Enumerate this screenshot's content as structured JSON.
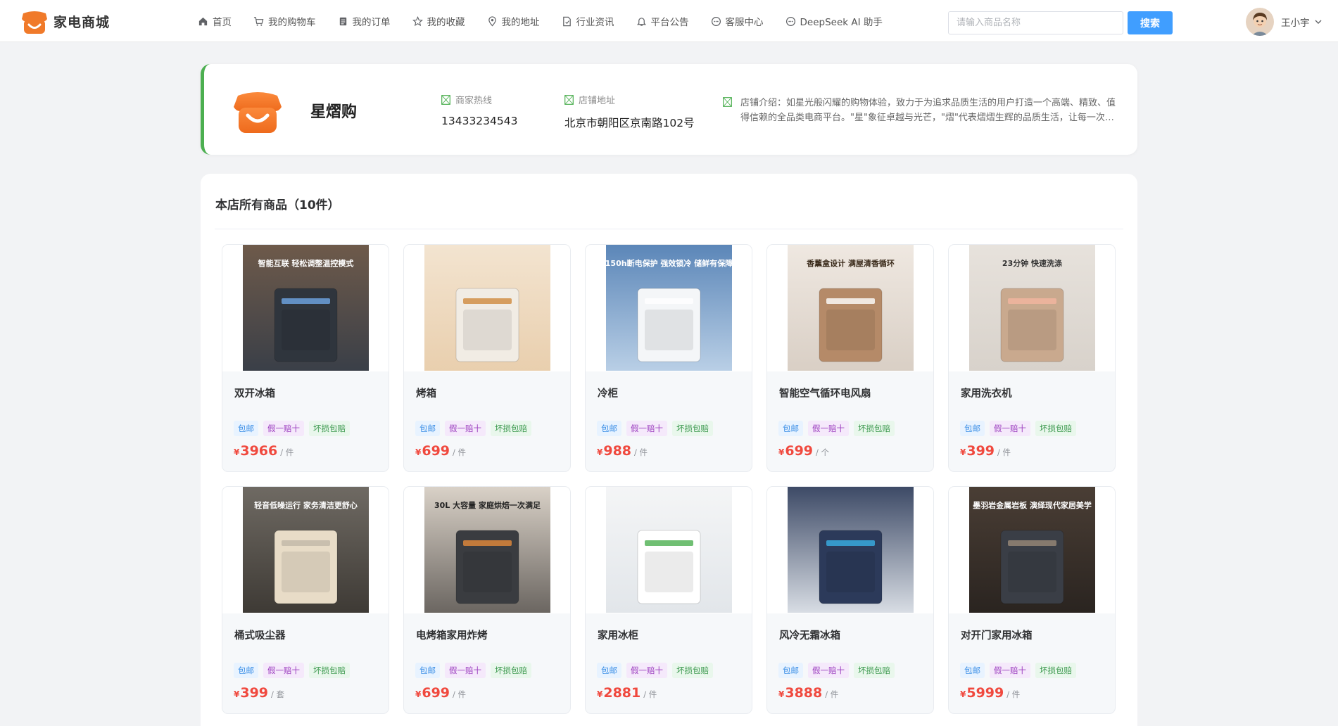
{
  "header": {
    "brand": "家电商城",
    "nav": [
      {
        "label": "首页",
        "icon": "home-icon"
      },
      {
        "label": "我的购物车",
        "icon": "cart-icon"
      },
      {
        "label": "我的订单",
        "icon": "order-icon"
      },
      {
        "label": "我的收藏",
        "icon": "star-icon"
      },
      {
        "label": "我的地址",
        "icon": "location-icon"
      },
      {
        "label": "行业资讯",
        "icon": "document-icon"
      },
      {
        "label": "平台公告",
        "icon": "bell-icon"
      },
      {
        "label": "客服中心",
        "icon": "chat-icon"
      },
      {
        "label": "DeepSeek AI 助手",
        "icon": "chat-icon"
      }
    ],
    "search_placeholder": "请输入商品名称",
    "search_button": "搜索",
    "user_name": "王小宇"
  },
  "shop": {
    "name": "星熠购",
    "hotline_label": "商家热线",
    "hotline": "13433234543",
    "address_label": "店铺地址",
    "address": "北京市朝阳区京南路102号",
    "intro": "店铺介绍：如星光般闪耀的购物体验，致力于为追求品质生活的用户打造一个高端、精致、值得信赖的全品类电商平台。\"星\"象征卓越与光芒，\"熠\"代表熠熠生辉的品质生活，让每一次购物都成为美好的享受。"
  },
  "products_section": {
    "title": "本店所有商品（10件）"
  },
  "tags": [
    "包邮",
    "假一赔十",
    "坏损包赔"
  ],
  "currency": "¥",
  "products": [
    {
      "name": "双开冰箱",
      "price": "3966",
      "unit": "/ 件",
      "img_caption": "智能互联 轻松调整温控模式"
    },
    {
      "name": "烤箱",
      "price": "699",
      "unit": "/ 件",
      "img_caption": ""
    },
    {
      "name": "冷柜",
      "price": "988",
      "unit": "/ 件",
      "img_caption": "150h断电保护 强效锁冷 储鲜有保障"
    },
    {
      "name": "智能空气循环电风扇",
      "price": "699",
      "unit": "/ 个",
      "img_caption": "香薰盒设计 满屋清香循环"
    },
    {
      "name": "家用洗衣机",
      "price": "399",
      "unit": "/ 件",
      "img_caption": "23分钟 快速洗涤"
    },
    {
      "name": "桶式吸尘器",
      "price": "399",
      "unit": "/ 套",
      "img_caption": "轻音低噪运行 家务清洁更舒心"
    },
    {
      "name": "电烤箱家用炸烤",
      "price": "699",
      "unit": "/ 件",
      "img_caption": "30L 大容量 家庭烘焙一次满足"
    },
    {
      "name": "家用冰柜",
      "price": "2881",
      "unit": "/ 件",
      "img_caption": ""
    },
    {
      "name": "风冷无霜冰箱",
      "price": "3888",
      "unit": "/ 件",
      "img_caption": ""
    },
    {
      "name": "对开门家用冰箱",
      "price": "5999",
      "unit": "/ 件",
      "img_caption": "墨羽岩金属岩板 演绎现代家居美学"
    }
  ],
  "colors": {
    "accent": "#409eff",
    "price": "#f0493e",
    "shop_border": "#4caf50",
    "logo_orange": "#f07a2a"
  }
}
